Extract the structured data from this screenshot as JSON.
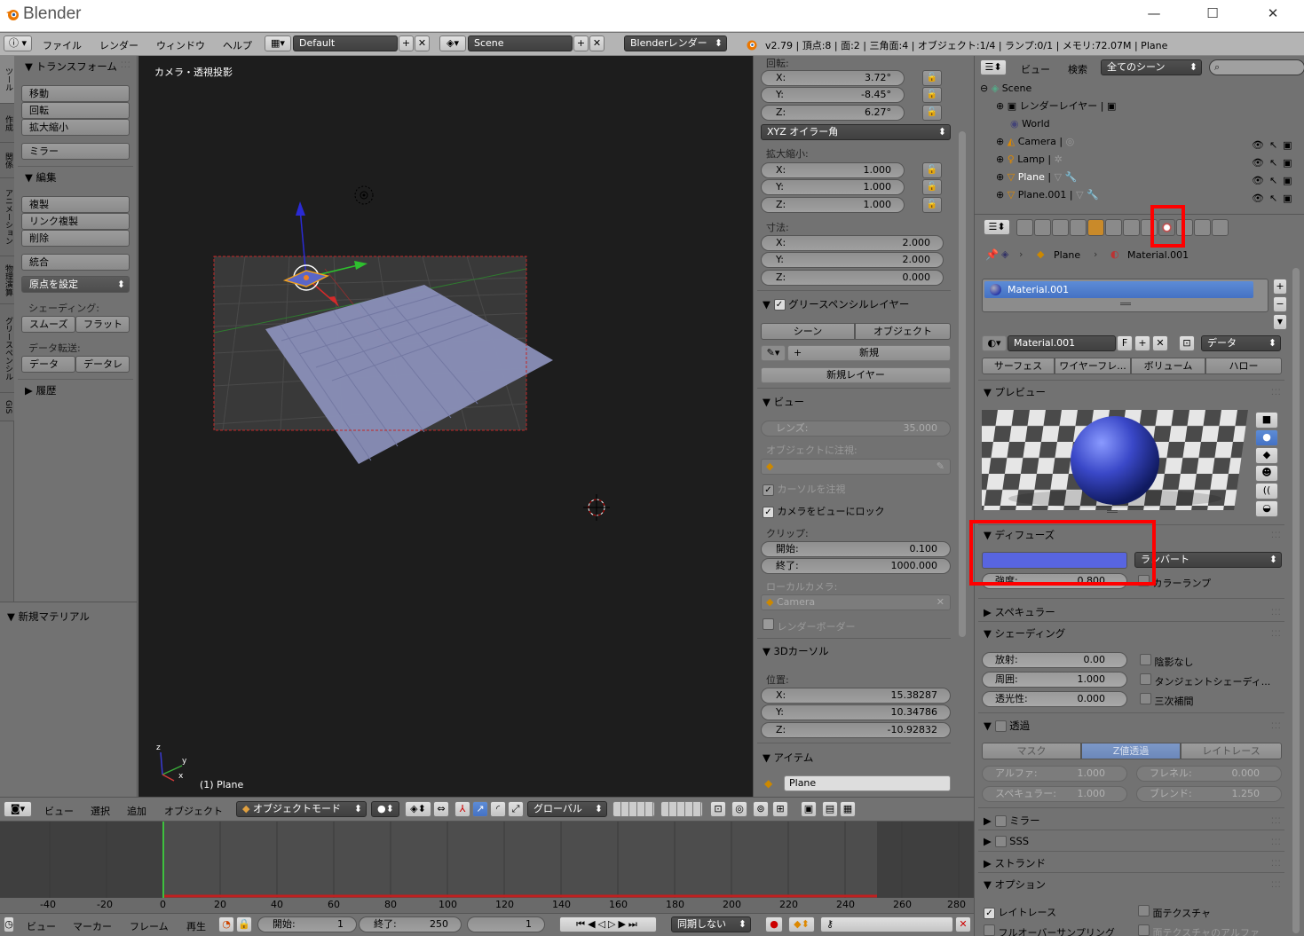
{
  "window": {
    "title": "Blender",
    "minimize": "—",
    "maximize": "☐",
    "close": "✕"
  },
  "info_header": {
    "menus": [
      "ファイル",
      "レンダー",
      "ウィンドウ",
      "ヘルプ"
    ],
    "layout": "Default",
    "scene": "Scene",
    "engine": "Blenderレンダー",
    "stats": "v2.79 | 頂点:8 | 面:2 | 三角面:4 | オブジェクト:1/4 | ランプ:0/1 | メモリ:72.07M | Plane"
  },
  "tool_tabs": [
    "ツール",
    "作成",
    "関係",
    "アニメーション",
    "物理演算",
    "グリースペンシル",
    "GIS"
  ],
  "tool_shelf": {
    "transform_header": "トランスフォーム",
    "move": "移動",
    "rotate": "回転",
    "scale": "拡大縮小",
    "mirror": "ミラー",
    "edit_header": "編集",
    "duplicate": "複製",
    "link_duplicate": "リンク複製",
    "delete": "削除",
    "join": "統合",
    "set_origin": "原点を設定",
    "shading_label": "シェーディング:",
    "smooth": "スムーズ",
    "flat": "フラット",
    "data_transfer_label": "データ転送:",
    "data": "データ",
    "data_layout": "データレ",
    "history_header": "履歴",
    "new_material_header": "新規マテリアル"
  },
  "viewport": {
    "label": "カメラ・透視投影",
    "object_label": "(1) Plane",
    "axis_x": "x",
    "axis_y": "y",
    "axis_z": "z"
  },
  "npanel": {
    "rotation_label": "回転:",
    "rot_x": {
      "k": "X:",
      "v": "3.72°"
    },
    "rot_y": {
      "k": "Y:",
      "v": "-8.45°"
    },
    "rot_z": {
      "k": "Z:",
      "v": "6.27°"
    },
    "rot_mode": "XYZ オイラー角",
    "scale_label": "拡大縮小:",
    "sc_x": {
      "k": "X:",
      "v": "1.000"
    },
    "sc_y": {
      "k": "Y:",
      "v": "1.000"
    },
    "sc_z": {
      "k": "Z:",
      "v": "1.000"
    },
    "dim_label": "寸法:",
    "dim_x": {
      "k": "X:",
      "v": "2.000"
    },
    "dim_y": {
      "k": "Y:",
      "v": "2.000"
    },
    "dim_z": {
      "k": "Z:",
      "v": "0.000"
    },
    "grease_header": "グリースペンシルレイヤー",
    "scene_tab": "シーン",
    "object_tab": "オブジェクト",
    "new": "新規",
    "new_layer": "新規レイヤー",
    "view_header": "ビュー",
    "lens": {
      "k": "レンズ:",
      "v": "35.000"
    },
    "lock_object_label": "オブジェクトに注視:",
    "lock_cursor": "カーソルを注視",
    "lock_camera": "カメラをビューにロック",
    "clip_label": "クリップ:",
    "clip_start": {
      "k": "開始:",
      "v": "0.100"
    },
    "clip_end": {
      "k": "終了:",
      "v": "1000.000"
    },
    "local_camera_label": "ローカルカメラ:",
    "camera": "Camera",
    "render_border": "レンダーボーダー",
    "cursor_header": "3Dカーソル",
    "location_label": "位置:",
    "cur_x": {
      "k": "X:",
      "v": "15.38287"
    },
    "cur_y": {
      "k": "Y:",
      "v": "10.34786"
    },
    "cur_z": {
      "k": "Z:",
      "v": "-10.92832"
    },
    "item_header": "アイテム",
    "item_name": "Plane"
  },
  "view3d_header": {
    "menus": [
      "ビュー",
      "選択",
      "追加",
      "オブジェクト"
    ],
    "mode": "オブジェクトモード",
    "orientation": "グローバル"
  },
  "timeline": {
    "ticks": [
      "-40",
      "-20",
      "0",
      "20",
      "40",
      "60",
      "80",
      "100",
      "120",
      "140",
      "160",
      "180",
      "200",
      "220",
      "240",
      "260",
      "280"
    ],
    "menus": [
      "ビュー",
      "マーカー",
      "フレーム",
      "再生"
    ],
    "start": {
      "k": "開始:",
      "v": "1"
    },
    "end": {
      "k": "終了:",
      "v": "250"
    },
    "current": "1",
    "sync": "同期しない"
  },
  "outliner": {
    "menus": [
      "ビュー",
      "検索"
    ],
    "filter": "全てのシーン",
    "rows": [
      "Scene",
      "レンダーレイヤー",
      "World",
      "Camera",
      "Lamp",
      "Plane",
      "Plane.001"
    ]
  },
  "properties": {
    "breadcrumb_object": "Plane",
    "breadcrumb_material": "Material.001",
    "slot": "Material.001",
    "material_name": "Material.001",
    "fake_user": "F",
    "link": "データ",
    "tabs": [
      "サーフェス",
      "ワイヤーフレ...",
      "ボリューム",
      "ハロー"
    ],
    "preview_header": "プレビュー",
    "diffuse_header": "ディフューズ",
    "diffuse_color": "#5865e0",
    "diffuse_shader": "ランバート",
    "intensity": {
      "k": "強度:",
      "v": "0.800"
    },
    "ramp": "カラーランプ",
    "specular_header": "スペキュラー",
    "shading_header": "シェーディング",
    "emit": {
      "k": "放射:",
      "v": "0.00"
    },
    "ambient": {
      "k": "周囲:",
      "v": "1.000"
    },
    "translucency": {
      "k": "透光性:",
      "v": "0.000"
    },
    "shadeless": "陰影なし",
    "tangent": "タンジェントシェーディ...",
    "cubic": "三次補間",
    "transparency_header": "透過",
    "trans_tabs": [
      "マスク",
      "Z値透過",
      "レイトレース"
    ],
    "alpha": {
      "k": "アルファ:",
      "v": "1.000"
    },
    "fresnel": {
      "k": "フレネル:",
      "v": "0.000"
    },
    "spec_alpha": {
      "k": "スペキュラー:",
      "v": "1.000"
    },
    "blend": {
      "k": "ブレンド:",
      "v": "1.250"
    },
    "mirror_header": "ミラー",
    "sss_header": "SSS",
    "strand_header": "ストランド",
    "options_header": "オプション",
    "raytrace": "レイトレース",
    "face_texture": "面テクスチャ",
    "full_oversampling": "フルオーバーサンプリング",
    "face_texture_alpha": "面テクスチャのアルファ"
  }
}
